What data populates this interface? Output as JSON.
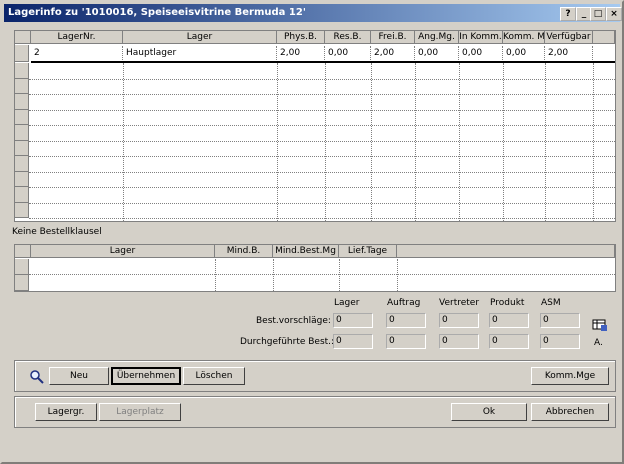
{
  "window": {
    "title": "Lagerinfo zu '1010016, Speiseeisvitrine Bermuda 12'",
    "controls": [
      "?",
      "_",
      "□",
      "×"
    ]
  },
  "top_grid": {
    "columns": [
      "LagerNr.",
      "Lager",
      "Phys.B.",
      "Res.B.",
      "Frei.B.",
      "Ang.Mg.",
      "In Komm.",
      "Komm. M",
      "Verfügbar"
    ],
    "rows": [
      [
        "2",
        "Hauptlager",
        "2,00",
        "0,00",
        "2,00",
        "0,00",
        "0,00",
        "0,00",
        "2,00"
      ]
    ]
  },
  "bestell_label": "Keine Bestellklausel",
  "bottom_grid": {
    "columns": [
      "Lager",
      "Mind.B.",
      "Mind.Best.Mg",
      "Lief.Tage"
    ]
  },
  "best": {
    "headers": [
      "Lager",
      "Auftrag",
      "Vertreter",
      "Produkt",
      "ASM"
    ],
    "vorschlaege_label": "Best.vorschläge:",
    "vorschlaege": [
      "0",
      "0",
      "0",
      "0",
      "0"
    ],
    "durchgefuehrt_label": "Durchgeführte Best.:",
    "durchgefuehrt": [
      "0",
      "0",
      "0",
      "0",
      "0"
    ],
    "a_label": "A."
  },
  "buttons": {
    "neu": "Neu",
    "uebernehmen": "Übernehmen",
    "loeschen": "Löschen",
    "komm_mge": "Komm.Mge",
    "lagergr": "Lagergr.",
    "lagerplatz": "Lagerplatz",
    "ok": "Ok",
    "abbrechen": "Abbrechen"
  }
}
